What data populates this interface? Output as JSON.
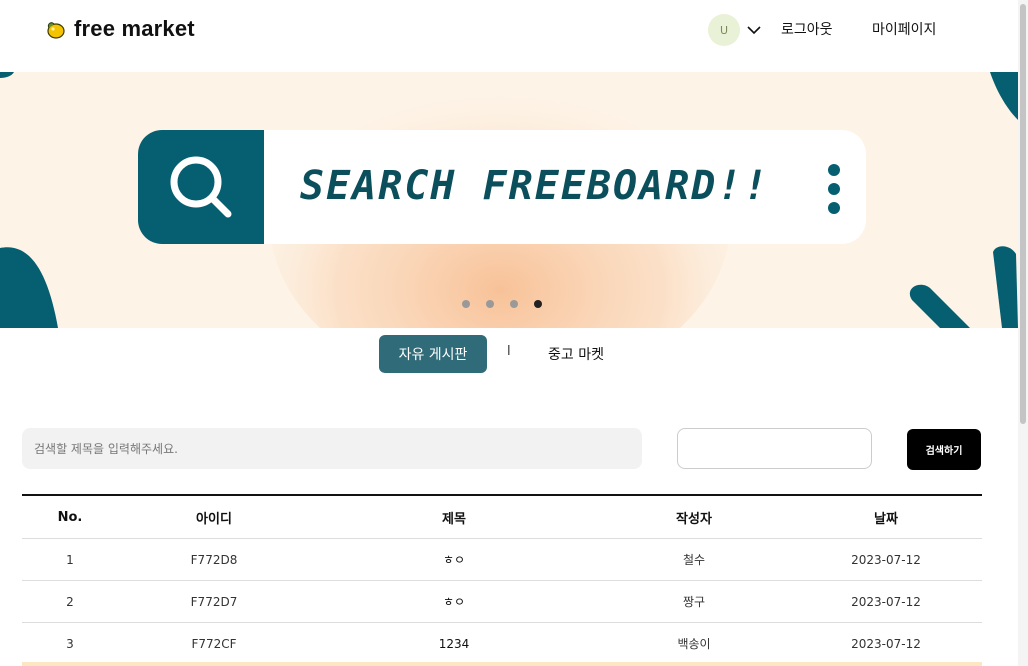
{
  "header": {
    "logo_text": "free market",
    "avatar_initial": "U",
    "logout_label": "로그아웃",
    "mypage_label": "마이페이지"
  },
  "banner": {
    "title": "SEARCH FREEBOARD!!",
    "slides_count": 4,
    "active_slide": 4
  },
  "tabs": {
    "board_label": "자유 게시판",
    "separator": "l",
    "market_label": "중고 마켓"
  },
  "search": {
    "placeholder": "검색할 제목을 입력해주세요.",
    "date_value": "",
    "button_label": "검색하기"
  },
  "table": {
    "headers": [
      "No.",
      "아이디",
      "제목",
      "작성자",
      "날짜"
    ],
    "rows": [
      [
        "1",
        "F772D8",
        "ㅎㅇ",
        "철수",
        "2023-07-12"
      ],
      [
        "2",
        "F772D7",
        "ㅎㅇ",
        "짱구",
        "2023-07-12"
      ],
      [
        "3",
        "F772CF",
        "1234",
        "백송이",
        "2023-07-12"
      ]
    ]
  },
  "colors": {
    "brand_teal": "#065f71",
    "tab_active_bg": "#2f6b78",
    "banner_bg": "#fdf3e6"
  }
}
